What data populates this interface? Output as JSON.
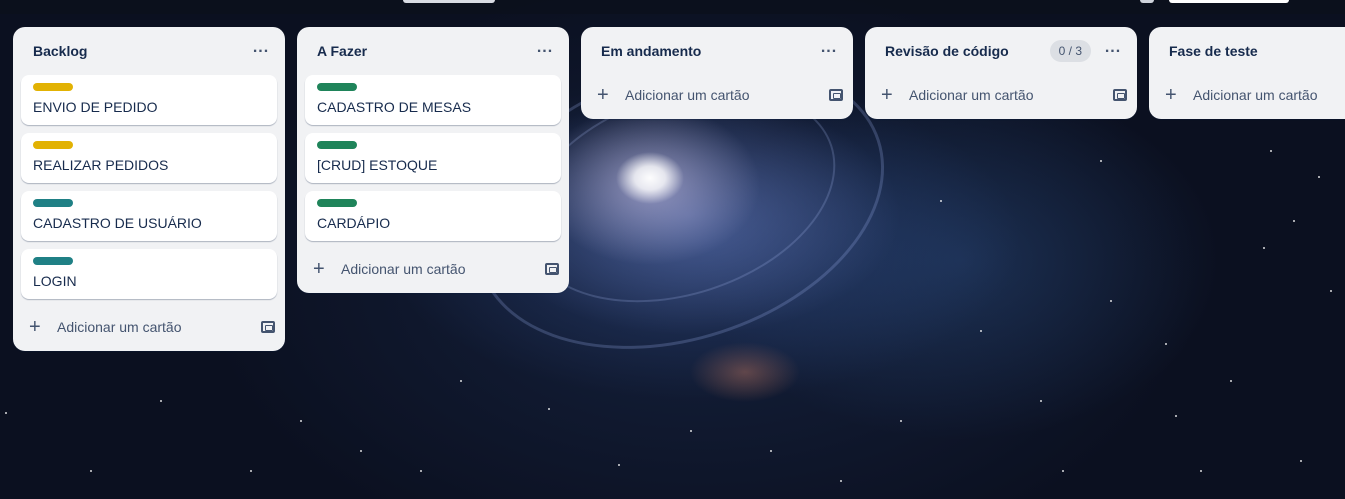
{
  "board": {
    "lists": [
      {
        "title": "Backlog",
        "badge": "",
        "cards": [
          {
            "label_color": "#e2b203",
            "title": "ENVIO DE PEDIDO"
          },
          {
            "label_color": "#e2b203",
            "title": "REALIZAR PEDIDOS"
          },
          {
            "label_color": "#1f8085",
            "title": "CADASTRO DE USUÁRIO"
          },
          {
            "label_color": "#1f8085",
            "title": "LOGIN"
          }
        ],
        "add_label": "Adicionar um cartão"
      },
      {
        "title": "A Fazer",
        "badge": "",
        "cards": [
          {
            "label_color": "#1f845a",
            "title": "CADASTRO DE MESAS"
          },
          {
            "label_color": "#1f845a",
            "title": "[CRUD] ESTOQUE"
          },
          {
            "label_color": "#1f845a",
            "title": "CARDÁPIO"
          }
        ],
        "add_label": "Adicionar um cartão"
      },
      {
        "title": "Em andamento",
        "badge": "",
        "cards": [],
        "add_label": "Adicionar um cartão"
      },
      {
        "title": "Revisão de código",
        "badge": "0 / 3",
        "cards": [],
        "add_label": "Adicionar um cartão"
      },
      {
        "title": "Fase de teste",
        "badge": "",
        "cards": [],
        "add_label": "Adicionar um cartão"
      }
    ],
    "icons": {
      "list_menu": "ellipsis-icon",
      "add": "plus-icon",
      "template": "card-template-icon"
    },
    "colors": {
      "list_background": "#f1f2f4",
      "card_background": "#ffffff",
      "text": "#172b4d",
      "muted_text": "#44546f"
    }
  }
}
